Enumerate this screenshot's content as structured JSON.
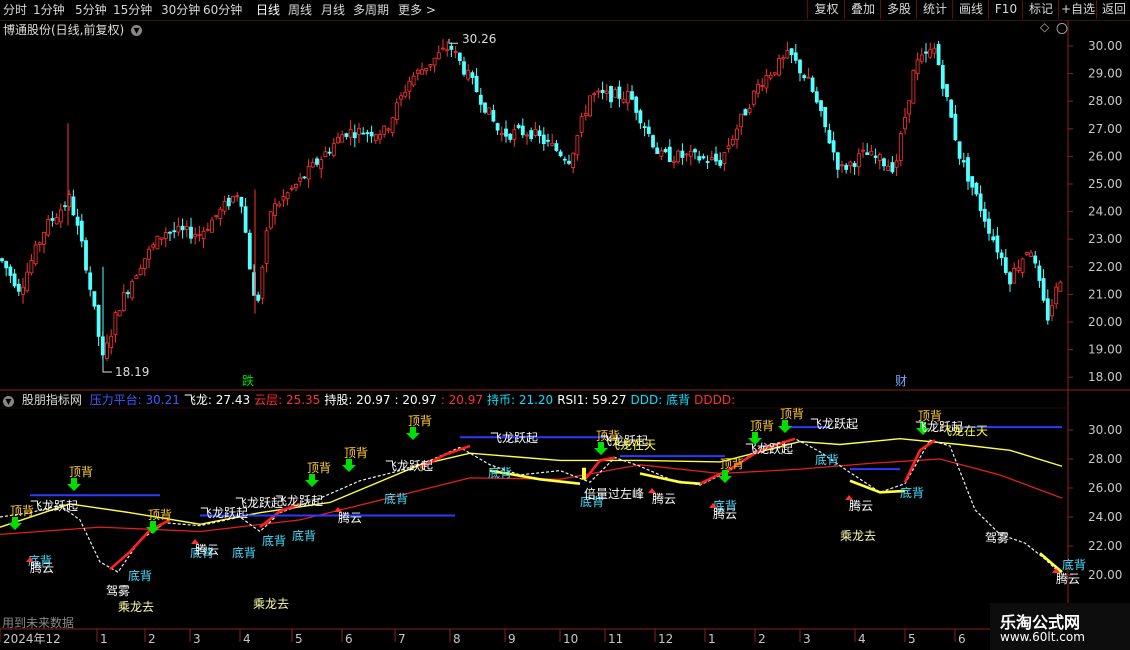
{
  "toolbar": {
    "periods": [
      "分时",
      "1分钟",
      "5分钟",
      "15分钟",
      "30分钟",
      "60分钟",
      "日线",
      "周线",
      "月线",
      "多周期",
      "更多 >"
    ],
    "active_period": "日线",
    "right_buttons": [
      "复权",
      "叠加",
      "多股",
      "统计",
      "画线",
      "F10",
      "标记",
      "+自选",
      "返回"
    ]
  },
  "stock": {
    "title": "博通股份(日线,前复权)",
    "high_label": "30.26",
    "low_label": "18.19",
    "event_labels": [
      "跌",
      "财"
    ]
  },
  "price_axis": [
    "30.00",
    "29.00",
    "28.00",
    "27.00",
    "26.00",
    "25.00",
    "24.00",
    "23.00",
    "22.00",
    "21.00",
    "20.00",
    "19.00",
    "18.00"
  ],
  "indicator": {
    "name": "股朋指标网",
    "fields": [
      {
        "label": "压力平台:",
        "value": "30.21",
        "color": "#3a5bff"
      },
      {
        "label": "飞龙:",
        "value": "27.43",
        "color": "#ffffff"
      },
      {
        "label": "云层:",
        "value": "25.35",
        "color": "#ff3030"
      },
      {
        "label": "持股:",
        "value": "20.97",
        "color": "#ffffff"
      },
      {
        "label": ":",
        "value": "20.97",
        "color": "#ffffff"
      },
      {
        "label": ":",
        "value": "20.97",
        "color": "#ff3030"
      },
      {
        "label": "持币:",
        "value": "21.20",
        "color": "#00e0ff"
      },
      {
        "label": "RSI1:",
        "value": "59.27",
        "color": "#ffffff"
      },
      {
        "label": "DDD:",
        "value": "底背",
        "color": "#00e0ff"
      },
      {
        "label": "DDDD:",
        "value": "",
        "color": "#ff3030"
      }
    ],
    "axis": [
      "30.00",
      "28.00",
      "26.00",
      "24.00",
      "22.00",
      "20.00"
    ],
    "signals": {
      "top_diverge": "顶背",
      "fly_up": "飞龙跃起",
      "bottom_diverge": "底背",
      "cloud": "腾云",
      "dragon_go": "乘龙去",
      "fog": "驾雾",
      "peak": "倍量过左峰",
      "sky": "飞龙在天"
    }
  },
  "footer_note": "用到未来数据",
  "date_axis": [
    "2024年12",
    "1",
    "2",
    "3",
    "4",
    "5",
    "6",
    "7",
    "8",
    "9",
    "10",
    "11",
    "12",
    "1",
    "2",
    "3",
    "4",
    "5",
    "6"
  ],
  "watermark": {
    "name": "乐淘公式网",
    "url": "www.60lt.com"
  },
  "colors": {
    "up": "#ff3232",
    "down": "#54ffff",
    "axis": "#8a2020",
    "yellow": "#ffff40",
    "blue": "#2a3aff",
    "green": "#00e000"
  }
}
